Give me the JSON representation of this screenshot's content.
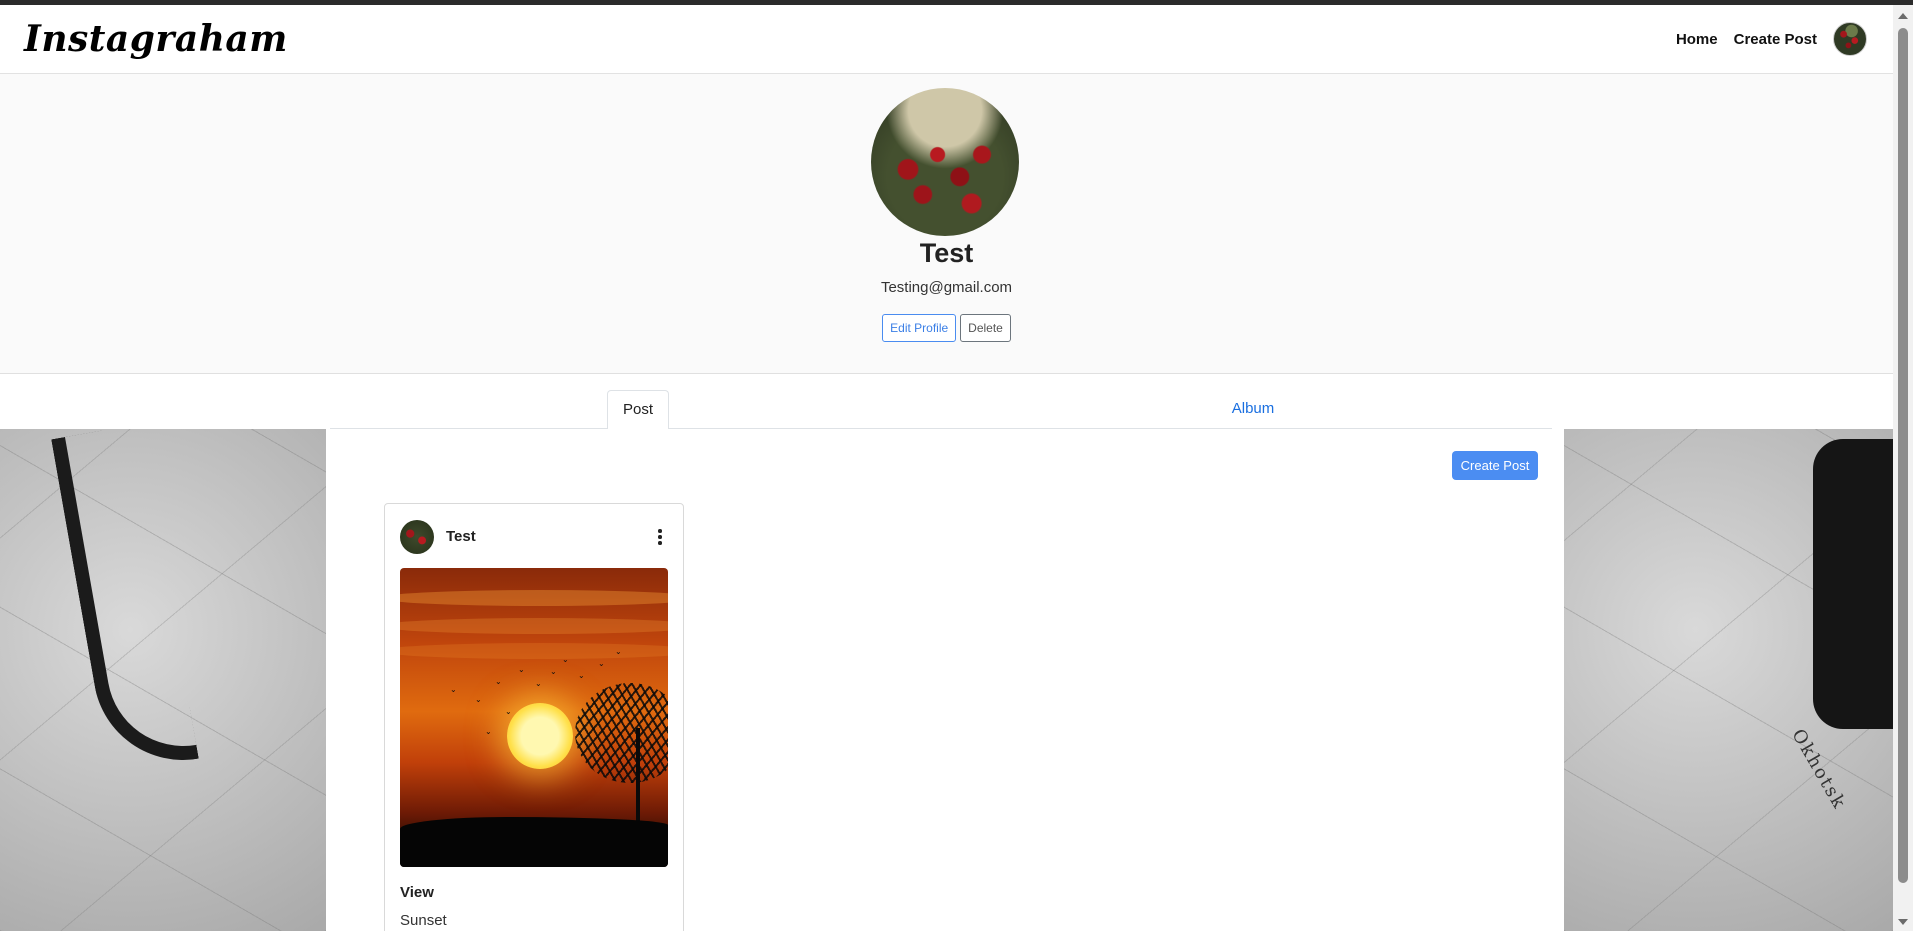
{
  "navbar": {
    "brand": "Instagraham",
    "links": [
      "Home",
      "Create Post"
    ]
  },
  "profile": {
    "name": "Test",
    "email": "Testing@gmail.com",
    "edit_label": "Edit Profile",
    "delete_label": "Delete"
  },
  "tabs": {
    "post": "Post",
    "album": "Album"
  },
  "main": {
    "create_post_label": "Create Post"
  },
  "post": {
    "username": "Test",
    "view_label": "View",
    "caption": "Sunset"
  },
  "background": {
    "map_text": "Okhotsk"
  },
  "colors": {
    "primary": "#4b8df2",
    "link": "#1a6fe0",
    "header_bg": "#fafafa"
  }
}
